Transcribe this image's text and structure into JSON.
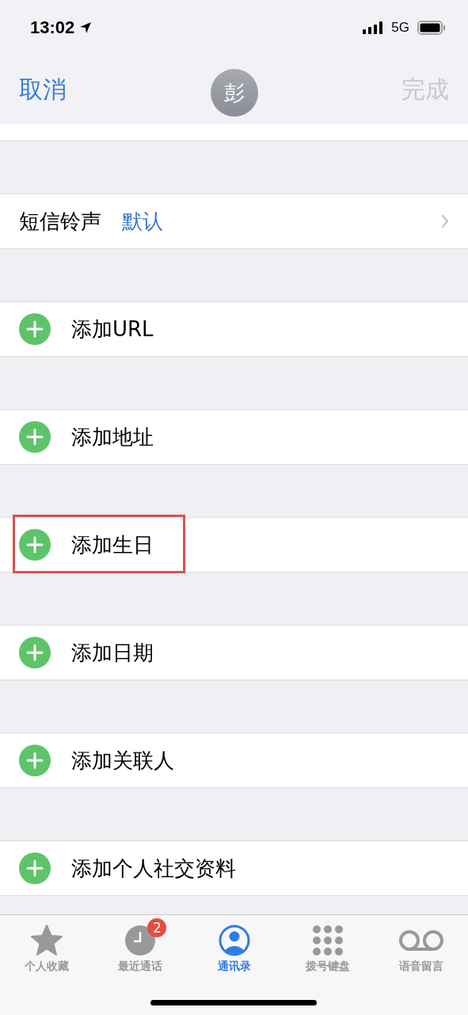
{
  "status_bar": {
    "time": "13:02",
    "network": "5G"
  },
  "nav": {
    "cancel": "取消",
    "avatar": "彭",
    "done": "完成",
    "done_disabled": true
  },
  "rows": [
    {
      "kind": "link",
      "label": "短信铃声",
      "value": "默认",
      "highlighted": false
    },
    {
      "kind": "add",
      "label": "添加URL",
      "highlighted": false
    },
    {
      "kind": "add",
      "label": "添加地址",
      "highlighted": false
    },
    {
      "kind": "add",
      "label": "添加生日",
      "highlighted": true
    },
    {
      "kind": "add",
      "label": "添加日期",
      "highlighted": false
    },
    {
      "kind": "add",
      "label": "添加关联人",
      "highlighted": false
    },
    {
      "kind": "add",
      "label": "添加个人社交资料",
      "highlighted": false
    }
  ],
  "tab_bar": [
    {
      "kind": "star",
      "label": "个人收藏",
      "selected": false
    },
    {
      "kind": "clock",
      "label": "最近通话",
      "selected": false,
      "badge": "2"
    },
    {
      "kind": "person",
      "label": "通讯录",
      "selected": true
    },
    {
      "kind": "keypad",
      "label": "拨号键盘",
      "selected": false
    },
    {
      "kind": "voicemail",
      "label": "语音留言",
      "selected": false
    }
  ]
}
